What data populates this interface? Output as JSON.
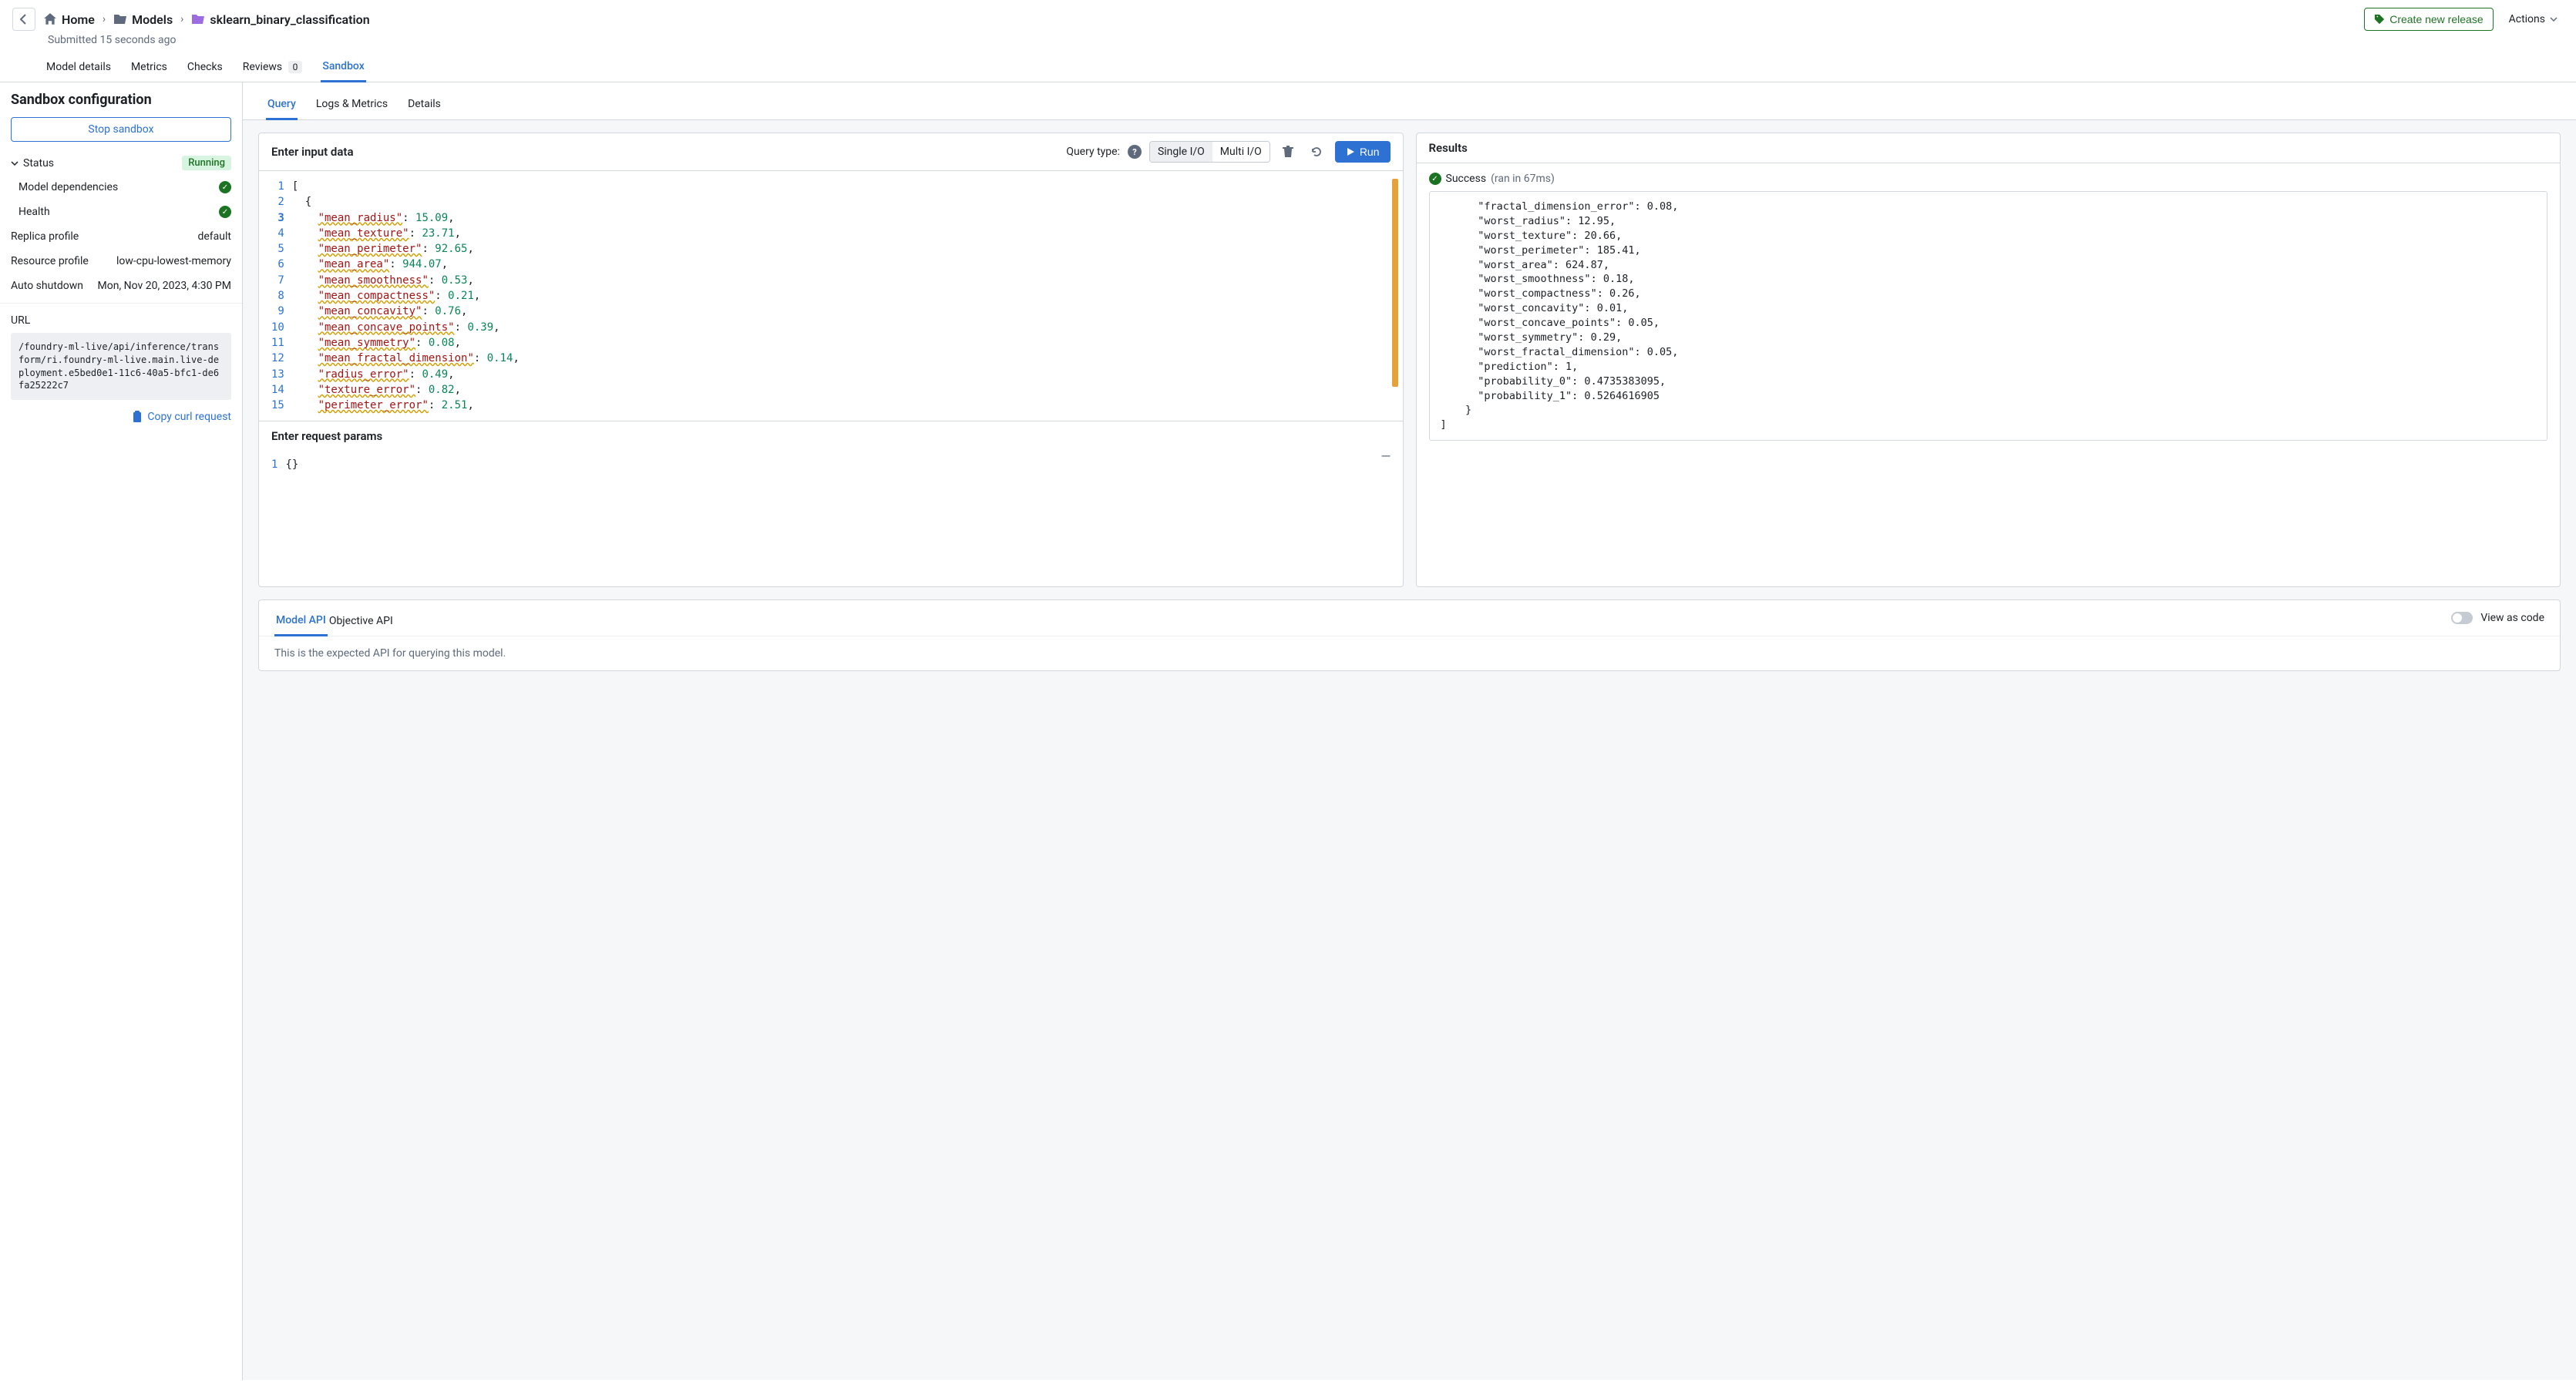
{
  "breadcrumb": {
    "home": "Home",
    "models": "Models",
    "current": "sklearn_binary_classification"
  },
  "submitted": "Submitted 15 seconds ago",
  "header_actions": {
    "create_release": "Create new release",
    "actions": "Actions"
  },
  "main_tabs": {
    "model_details": "Model details",
    "metrics": "Metrics",
    "checks": "Checks",
    "reviews": "Reviews",
    "reviews_count": "0",
    "sandbox": "Sandbox"
  },
  "sidebar": {
    "title": "Sandbox configuration",
    "stop": "Stop sandbox",
    "status_label": "Status",
    "status_value": "Running",
    "model_deps": "Model dependencies",
    "health": "Health",
    "replica_label": "Replica profile",
    "replica_value": "default",
    "resource_label": "Resource profile",
    "resource_value": "low-cpu-lowest-memory",
    "shutdown_label": "Auto shutdown",
    "shutdown_value": "Mon, Nov 20, 2023, 4:30 PM",
    "url_label": "URL",
    "url_value": "/foundry-ml-live/api/inference/transform/ri.foundry-ml-live.main.live-deployment.e5bed0e1-11c6-40a5-bfc1-de6fa25222c7",
    "copy_curl": "Copy curl request"
  },
  "sub_tabs": {
    "query": "Query",
    "logs": "Logs & Metrics",
    "details": "Details"
  },
  "input_panel": {
    "title": "Enter input data",
    "query_type_label": "Query type:",
    "single": "Single I/O",
    "multi": "Multi I/O",
    "run": "Run",
    "params_title": "Enter request params",
    "params_code": "{}",
    "code_lines": [
      {
        "n": 1,
        "raw": "["
      },
      {
        "n": 2,
        "raw": "  {"
      },
      {
        "n": 3,
        "key": "mean_radius",
        "val": "15.09"
      },
      {
        "n": 4,
        "key": "mean_texture",
        "val": "23.71"
      },
      {
        "n": 5,
        "key": "mean_perimeter",
        "val": "92.65"
      },
      {
        "n": 6,
        "key": "mean_area",
        "val": "944.07"
      },
      {
        "n": 7,
        "key": "mean_smoothness",
        "val": "0.53"
      },
      {
        "n": 8,
        "key": "mean_compactness",
        "val": "0.21"
      },
      {
        "n": 9,
        "key": "mean_concavity",
        "val": "0.76"
      },
      {
        "n": 10,
        "key": "mean_concave_points",
        "val": "0.39"
      },
      {
        "n": 11,
        "key": "mean_symmetry",
        "val": "0.08"
      },
      {
        "n": 12,
        "key": "mean_fractal_dimension",
        "val": "0.14"
      },
      {
        "n": 13,
        "key": "radius_error",
        "val": "0.49"
      },
      {
        "n": 14,
        "key": "texture_error",
        "val": "0.82"
      },
      {
        "n": 15,
        "key": "perimeter_error",
        "val": "2.51"
      }
    ]
  },
  "results_panel": {
    "title": "Results",
    "success": "Success",
    "time": "(ran in 67ms)",
    "output": "      \"fractal_dimension_error\": 0.08,\n      \"worst_radius\": 12.95,\n      \"worst_texture\": 20.66,\n      \"worst_perimeter\": 185.41,\n      \"worst_area\": 624.87,\n      \"worst_smoothness\": 0.18,\n      \"worst_compactness\": 0.26,\n      \"worst_concavity\": 0.01,\n      \"worst_concave_points\": 0.05,\n      \"worst_symmetry\": 0.29,\n      \"worst_fractal_dimension\": 0.05,\n      \"prediction\": 1,\n      \"probability_0\": 0.4735383095,\n      \"probability_1\": 0.5264616905\n    }\n]"
  },
  "bottom": {
    "model_api": "Model API",
    "objective_api": "Objective API",
    "view_as_code": "View as code",
    "description": "This is the expected API for querying this model."
  }
}
